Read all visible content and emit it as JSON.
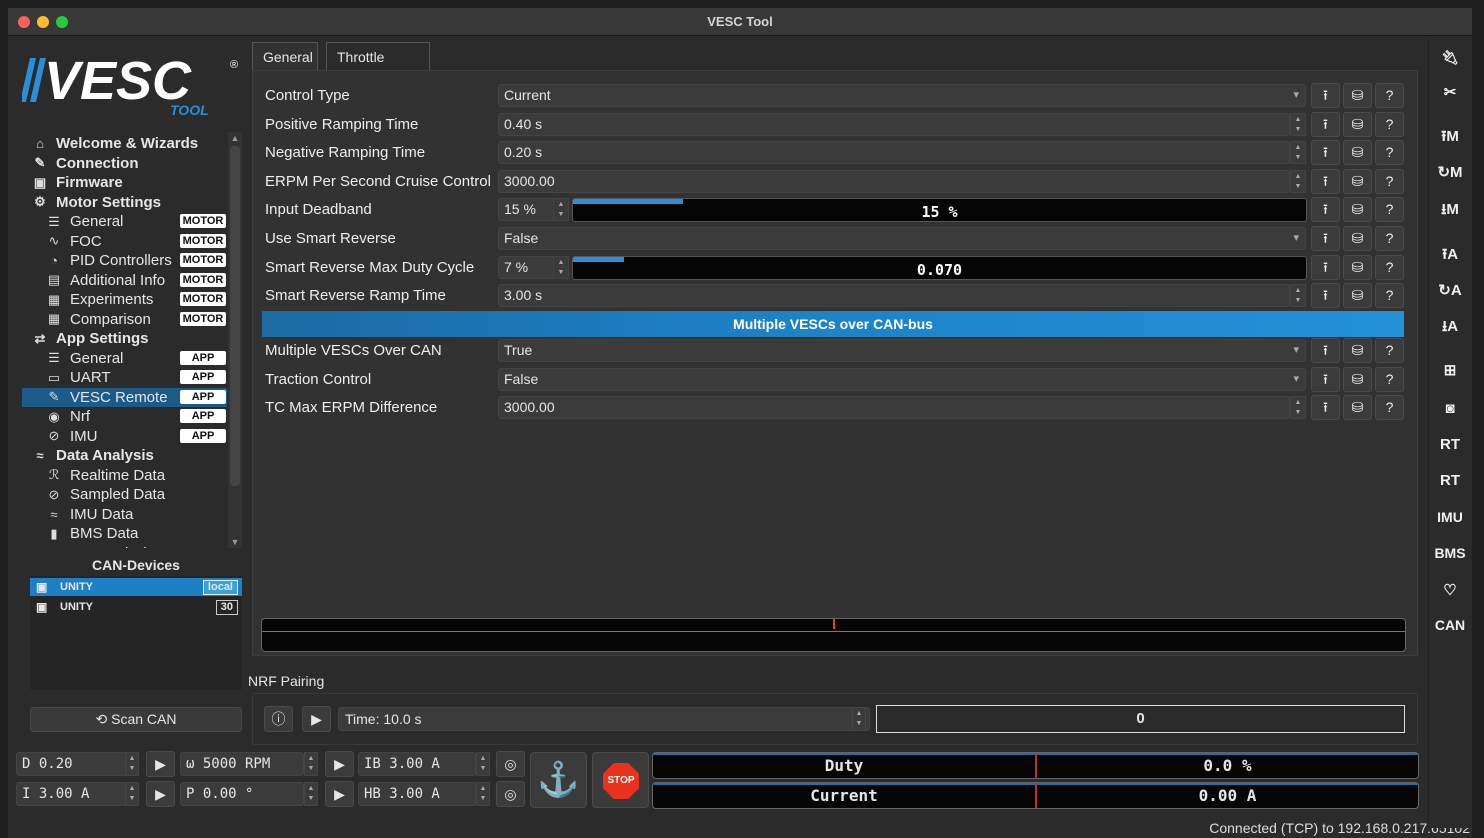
{
  "window": {
    "title": "VESC Tool"
  },
  "logo": {
    "text": "VESC",
    "sub": "TOOL",
    "reg": "®"
  },
  "nav": {
    "items": [
      {
        "label": "Welcome & Wizards",
        "icon": "home-icon",
        "glyph": "⌂",
        "level": "top",
        "badge": ""
      },
      {
        "label": "Connection",
        "icon": "plug-icon",
        "glyph": "✎",
        "level": "top",
        "badge": ""
      },
      {
        "label": "Firmware",
        "icon": "chip-icon",
        "glyph": "▣",
        "level": "top",
        "badge": ""
      },
      {
        "label": "Motor Settings",
        "icon": "motor-icon",
        "glyph": "⚙",
        "level": "top",
        "badge": ""
      },
      {
        "label": "General",
        "icon": "sliders-icon",
        "glyph": "☰",
        "level": "sub",
        "badge": "MOTOR"
      },
      {
        "label": "FOC",
        "icon": "foc-icon",
        "glyph": "∿",
        "level": "sub",
        "badge": "MOTOR"
      },
      {
        "label": "PID Controllers",
        "icon": "gauge-icon",
        "glyph": "◔",
        "level": "sub",
        "badge": "MOTOR"
      },
      {
        "label": "Additional Info",
        "icon": "info-icon",
        "glyph": "▤",
        "level": "sub",
        "badge": "MOTOR"
      },
      {
        "label": "Experiments",
        "icon": "calculator-icon",
        "glyph": "▦",
        "level": "sub",
        "badge": "MOTOR"
      },
      {
        "label": "Comparison",
        "icon": "compare-icon",
        "glyph": "▦",
        "level": "sub",
        "badge": "MOTOR"
      },
      {
        "label": "App Settings",
        "icon": "app-settings-icon",
        "glyph": "⇄",
        "level": "top",
        "badge": ""
      },
      {
        "label": "General",
        "icon": "sliders-icon",
        "glyph": "☰",
        "level": "sub",
        "badge": "APP"
      },
      {
        "label": "UART",
        "icon": "uart-icon",
        "glyph": "▭",
        "level": "sub",
        "badge": "APP"
      },
      {
        "label": "VESC Remote",
        "icon": "remote-icon",
        "glyph": "✎",
        "level": "sub",
        "badge": "APP",
        "selected": true
      },
      {
        "label": "Nrf",
        "icon": "wireless-icon",
        "glyph": "◉",
        "level": "sub",
        "badge": "APP"
      },
      {
        "label": "IMU",
        "icon": "imu-icon",
        "glyph": "⊘",
        "level": "sub",
        "badge": "APP"
      },
      {
        "label": "Data Analysis",
        "icon": "analysis-icon",
        "glyph": "≈",
        "level": "top",
        "badge": ""
      },
      {
        "label": "Realtime Data",
        "icon": "realtime-icon",
        "glyph": "ℛ",
        "level": "sub",
        "badge": ""
      },
      {
        "label": "Sampled Data",
        "icon": "sampled-icon",
        "glyph": "⊘",
        "level": "sub",
        "badge": ""
      },
      {
        "label": "IMU Data",
        "icon": "imu-data-icon",
        "glyph": "≈",
        "level": "sub",
        "badge": ""
      },
      {
        "label": "BMS Data",
        "icon": "battery-icon",
        "glyph": "▮",
        "level": "sub",
        "badge": ""
      },
      {
        "label": "Log Analysis",
        "icon": "log-icon",
        "glyph": "▤",
        "level": "sub",
        "badge": ""
      }
    ]
  },
  "can": {
    "title": "CAN-Devices",
    "devices": [
      {
        "name": "UNITY",
        "badge": "local",
        "selected": true
      },
      {
        "name": "UNITY",
        "badge": "30",
        "selected": false
      }
    ],
    "scan_label": "⟲ Scan CAN"
  },
  "tabs": [
    {
      "label": "General",
      "active": true
    },
    {
      "label": "Throttle Curve",
      "active": false
    }
  ],
  "params": [
    {
      "label": "Control Type",
      "kind": "combo",
      "value": "Current"
    },
    {
      "label": "Positive Ramping Time",
      "kind": "spin",
      "value": "0.40 s"
    },
    {
      "label": "Negative Ramping Time",
      "kind": "spin",
      "value": "0.20 s"
    },
    {
      "label": "ERPM Per Second Cruise Control",
      "kind": "spin",
      "value": "3000.00"
    },
    {
      "label": "Input Deadband",
      "kind": "pct",
      "value": "15 %",
      "bar_text": "15 %",
      "fill_percent": 15
    },
    {
      "label": "Use Smart Reverse",
      "kind": "combo",
      "value": "False"
    },
    {
      "label": "Smart Reverse Max Duty Cycle",
      "kind": "pct",
      "value": "7 %",
      "bar_text": "0.070",
      "fill_percent": 7
    },
    {
      "label": "Smart Reverse Ramp Time",
      "kind": "spin",
      "value": "3.00 s"
    }
  ],
  "section": {
    "title": "Multiple VESCs over CAN-bus"
  },
  "params2": [
    {
      "label": "Multiple VESCs Over CAN",
      "kind": "combo",
      "value": "True"
    },
    {
      "label": "Traction Control",
      "kind": "combo",
      "value": "False"
    },
    {
      "label": "TC Max ERPM Difference",
      "kind": "spin",
      "value": "3000.00"
    }
  ],
  "row_buttons": {
    "upload": "⭱",
    "database": "⛁",
    "help": "?"
  },
  "nrf": {
    "title": "NRF Pairing",
    "time": "Time: 10.0 s",
    "output": "0"
  },
  "controls": {
    "duty": "D 0.20",
    "rpm": "ω 5000 RPM",
    "ib": "IB 3.00 A",
    "current": "I 3.00 A",
    "pos": "P 0.00 °",
    "hb": "HB 3.00 A",
    "stop": "STOP"
  },
  "meters": [
    {
      "name": "Duty",
      "value": "0.0 %"
    },
    {
      "name": "Current",
      "value": "0.00 A"
    }
  ],
  "status": "Connected (TCP) to 192.168.0.217:65102",
  "toolbar": [
    {
      "icon": "connect-icon",
      "glyph": "🔌︎"
    },
    {
      "icon": "disconnect-icon",
      "glyph": "✂"
    },
    {
      "icon": "write-motor-icon",
      "glyph": "⭱M"
    },
    {
      "icon": "read-motor-icon",
      "glyph": "↻M"
    },
    {
      "icon": "read-motor-default-icon",
      "glyph": "⭳M"
    },
    {
      "icon": "write-app-icon",
      "glyph": "⭱A"
    },
    {
      "icon": "read-app-icon",
      "glyph": "↻A"
    },
    {
      "icon": "read-app-default-icon",
      "glyph": "⭳A"
    },
    {
      "icon": "can-network-icon",
      "glyph": "⊞"
    },
    {
      "icon": "gamepad-icon",
      "glyph": "◙"
    },
    {
      "icon": "realtime-stream-icon",
      "glyph": "RT"
    },
    {
      "icon": "realtime-app-icon",
      "glyph": "RT"
    },
    {
      "icon": "imu-stream-icon",
      "glyph": "IMU"
    },
    {
      "icon": "bms-stream-icon",
      "glyph": "BMS"
    },
    {
      "icon": "heart-icon",
      "glyph": "♡"
    },
    {
      "icon": "can-fwd-icon",
      "glyph": "CAN"
    }
  ]
}
